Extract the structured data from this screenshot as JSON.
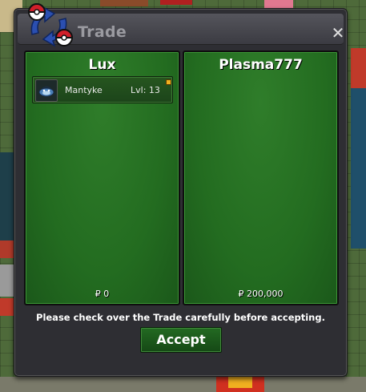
{
  "window": {
    "title": "Trade",
    "close_glyph": "✕"
  },
  "left_panel": {
    "player": "Lux",
    "items": [
      {
        "name": "Mantyke",
        "level": "Lvl: 13",
        "icon": "mantyke-icon"
      }
    ],
    "money": "₽ 0"
  },
  "right_panel": {
    "player": "Plasma777",
    "items": [],
    "money": "₽ 200,000"
  },
  "notice": "Please check over the Trade carefully before accepting.",
  "accept_label": "Accept",
  "colors": {
    "panel_green": "#236c20",
    "window_bg": "#2e2e33",
    "title_text": "#9a9aa0",
    "pokeball_red": "#d0202a",
    "arrow_blue": "#2b4fb0"
  }
}
